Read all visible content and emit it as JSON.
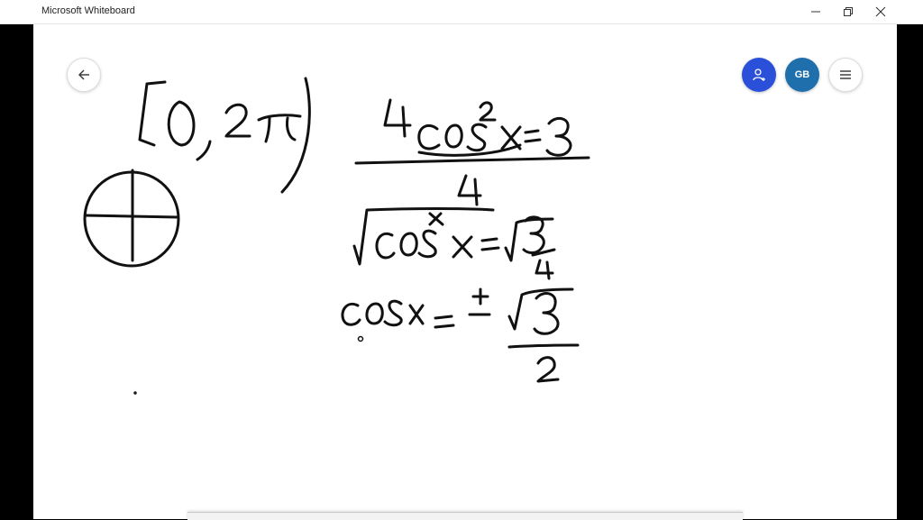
{
  "app": {
    "title": "Microsoft Whiteboard"
  },
  "window_controls": {
    "minimize_icon": "minimize-icon",
    "restore_icon": "restore-icon",
    "close_icon": "close-icon"
  },
  "toolbar": {
    "back_icon": "arrow-left-icon",
    "invite_icon": "add-person-icon",
    "avatar_initials": "GB",
    "menu_icon": "hamburger-menu-icon"
  },
  "colors": {
    "invite_button": "#2a4fd8",
    "avatar": "#1f6fad",
    "ink": "#111111"
  }
}
